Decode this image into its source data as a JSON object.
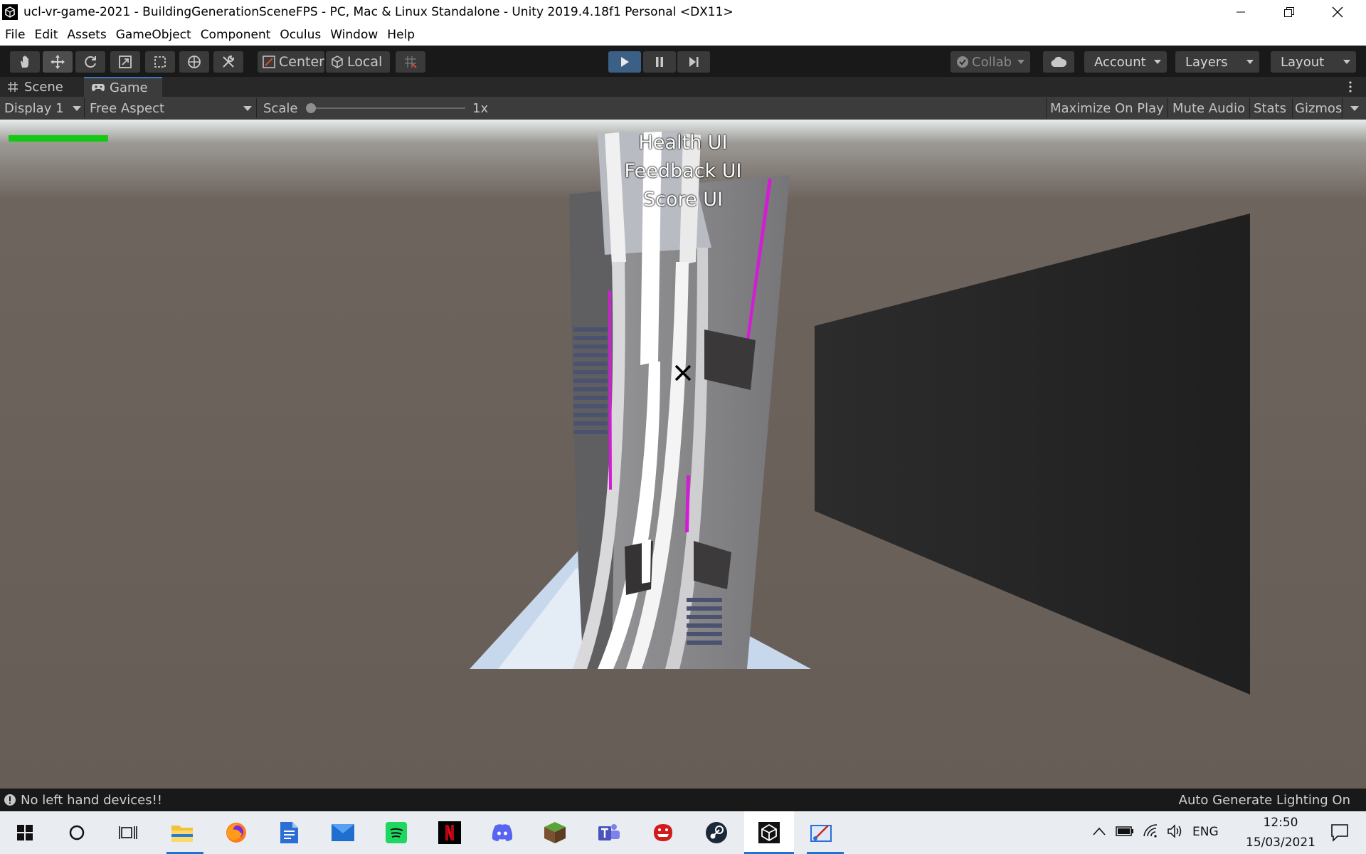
{
  "window": {
    "title": "ucl-vr-game-2021 - BuildingGenerationSceneFPS - PC, Mac & Linux Standalone - Unity 2019.4.18f1 Personal <DX11>"
  },
  "menu": [
    "File",
    "Edit",
    "Assets",
    "GameObject",
    "Component",
    "Oculus",
    "Window",
    "Help"
  ],
  "toolbar": {
    "pivot_label": "Center",
    "space_label": "Local",
    "collab_label": "Collab",
    "account_label": "Account",
    "layers_label": "Layers",
    "layout_label": "Layout"
  },
  "tabs": {
    "scene": "Scene",
    "game": "Game"
  },
  "game_toolbar": {
    "display": "Display 1",
    "aspect": "Free Aspect",
    "scale_label": "Scale",
    "scale_value": "1x",
    "maximize": "Maximize On Play",
    "mute": "Mute Audio",
    "stats": "Stats",
    "gizmos": "Gizmos"
  },
  "hud": {
    "health_ui": "Health UI",
    "feedback_ui": "Feedback UI",
    "score_ui": "Score UI"
  },
  "status": {
    "message": "No left hand devices!!",
    "lighting": "Auto Generate Lighting On"
  },
  "taskbar": {
    "language": "ENG",
    "time": "12:50",
    "date": "15/03/2021"
  },
  "colors": {
    "health_bar": "#14c814",
    "play_active": "#3c5f86",
    "tab_accent": "#3a79bb",
    "neon_stripe": "#d21ed2"
  }
}
